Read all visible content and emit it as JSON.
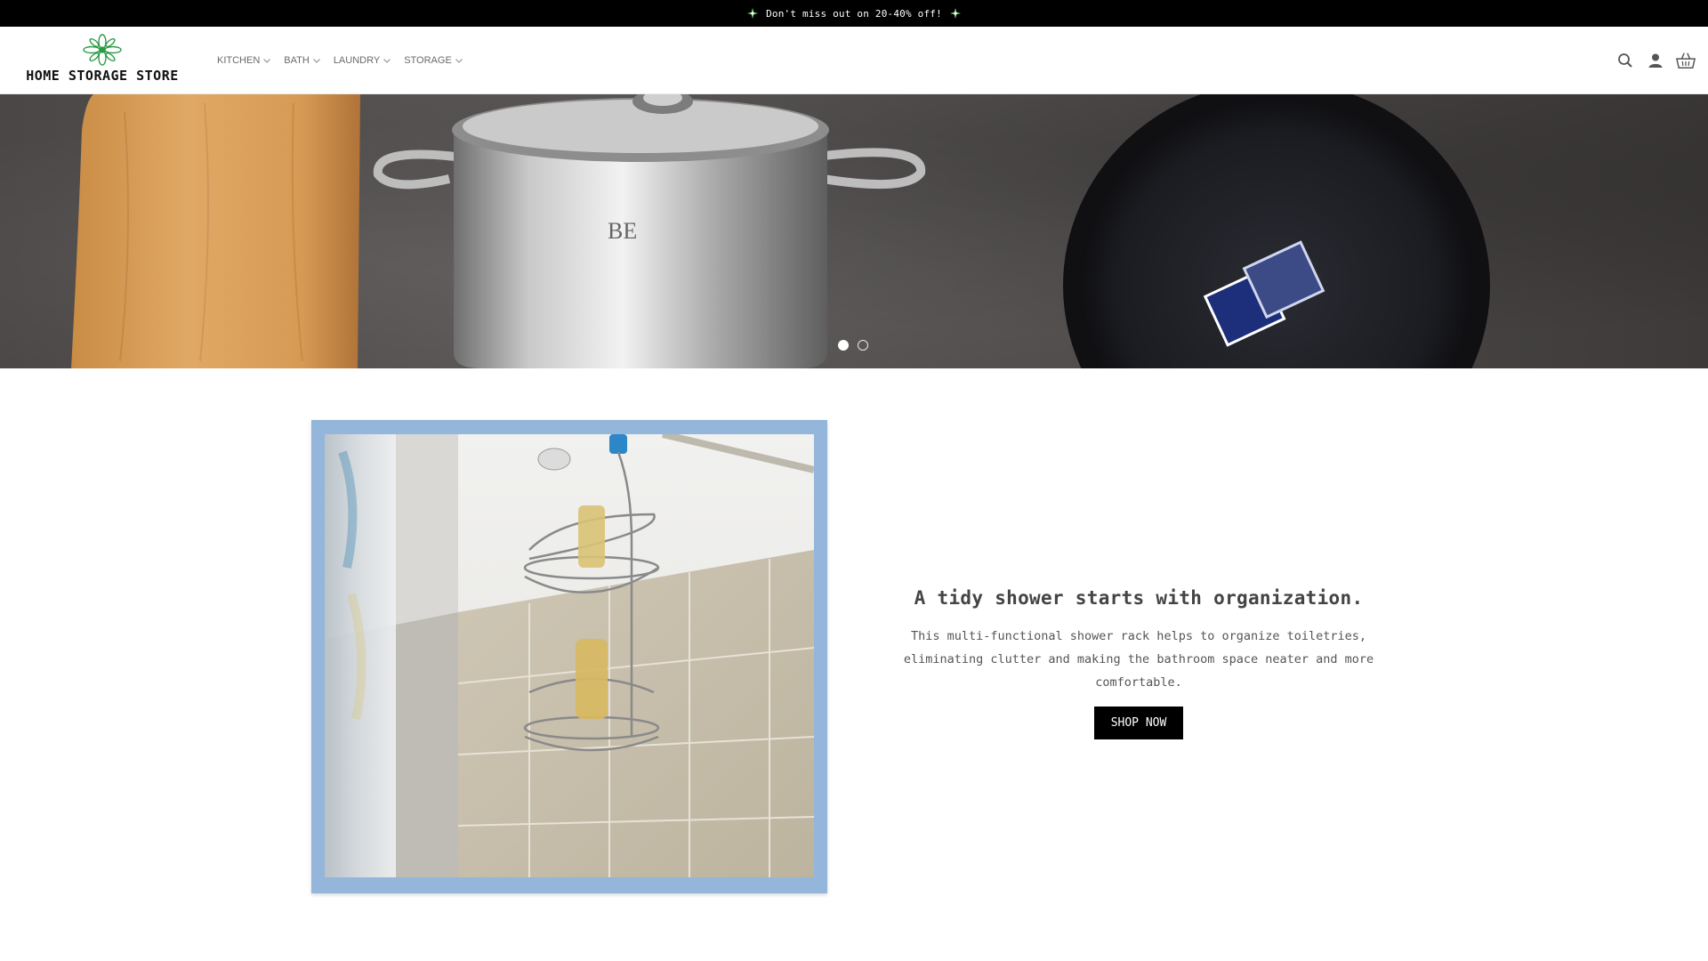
{
  "announcement": {
    "text": "Don't miss out on 20-40% off!",
    "icon": "sparkle-icon"
  },
  "brand": {
    "name": "HOME STORAGE STORE",
    "accent": "#2e9b45"
  },
  "nav": {
    "items": [
      {
        "label": "KITCHEN"
      },
      {
        "label": "BATH"
      },
      {
        "label": "LAUNDRY"
      },
      {
        "label": "STORAGE"
      }
    ]
  },
  "header_icons": [
    "search-icon",
    "account-icon",
    "cart-icon"
  ],
  "hero": {
    "slide_count": 2,
    "active_slide": 1
  },
  "feature": {
    "title": "A tidy shower starts with organization.",
    "body": "This multi-functional shower rack helps to organize toiletries, eliminating clutter and making the bathroom space neater and more comfortable.",
    "button_label": "SHOP NOW",
    "frame_color": "#94b6db"
  }
}
